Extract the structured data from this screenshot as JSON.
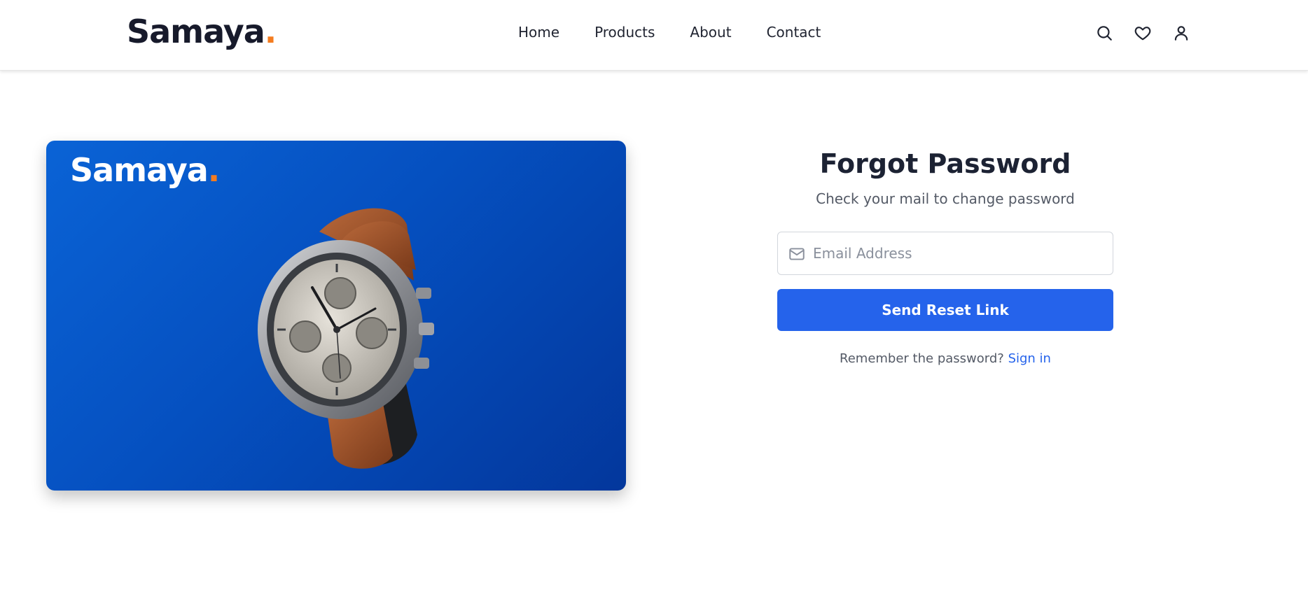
{
  "header": {
    "logo": "Samaya",
    "logo_dot": ".",
    "nav": [
      "Home",
      "Products",
      "About",
      "Contact"
    ],
    "icons": [
      "search-icon",
      "heart-icon",
      "user-icon"
    ]
  },
  "hero": {
    "logo": "Samaya",
    "logo_dot": "."
  },
  "form": {
    "title": "Forgot Password",
    "subtitle": "Check your mail to change password",
    "email_placeholder": "Email Address",
    "submit_label": "Send Reset Link",
    "remember_text": "Remember the password?",
    "signin_label": "Sign in"
  },
  "colors": {
    "accent": "#2563eb",
    "logo_dot": "#f47c20",
    "hero_bg": "#0550c0"
  }
}
